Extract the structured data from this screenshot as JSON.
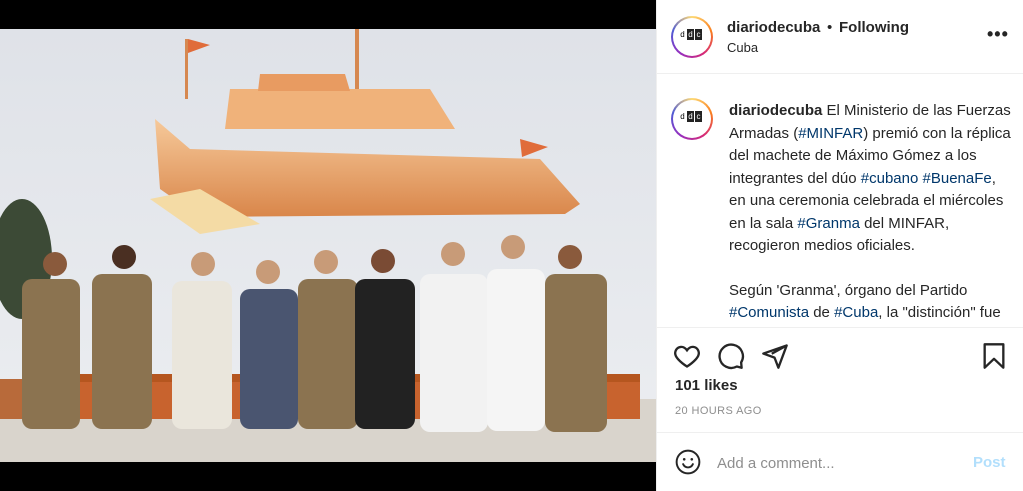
{
  "post": {
    "username": "diariodecuba",
    "separator": "•",
    "follow_state": "Following",
    "location": "Cuba",
    "more_label": "•••",
    "avatar_letters": [
      "d",
      "d",
      "c"
    ],
    "caption": {
      "username": "diariodecuba",
      "text_1": " El Ministerio de las Fuerzas Armadas (",
      "tag_minfar": "#MINFAR",
      "text_2": ") premió con la réplica del machete de Máximo Gómez a los integrantes del dúo ",
      "tag_cubano": "#cubano",
      "text_3": " ",
      "tag_buenafe": "#BuenaFe",
      "text_4": ", en una ceremonia celebrada el miércoles en la sala ",
      "tag_granma": "#Granma",
      "text_5": " del MINFAR, recogieron medios oficiales.",
      "para2_1": "Según 'Granma', órgano del Partido ",
      "tag_comunista": "#Comunista",
      "para2_2": " de ",
      "tag_cuba": "#Cuba",
      "para2_3": ", la \"distinción\" fue entregada a Israel Rojas y Yoel"
    },
    "likes": "101 likes",
    "timestamp": "20 HOURS AGO",
    "comment_placeholder": "Add a comment...",
    "post_button": "Post"
  },
  "colors": {
    "hashtag": "#00376b",
    "post_button_disabled": "#b2dffc",
    "muted": "#8e8e8e"
  },
  "icons": [
    "heart-icon",
    "comment-icon",
    "share-icon",
    "bookmark-icon",
    "emoji-icon"
  ]
}
